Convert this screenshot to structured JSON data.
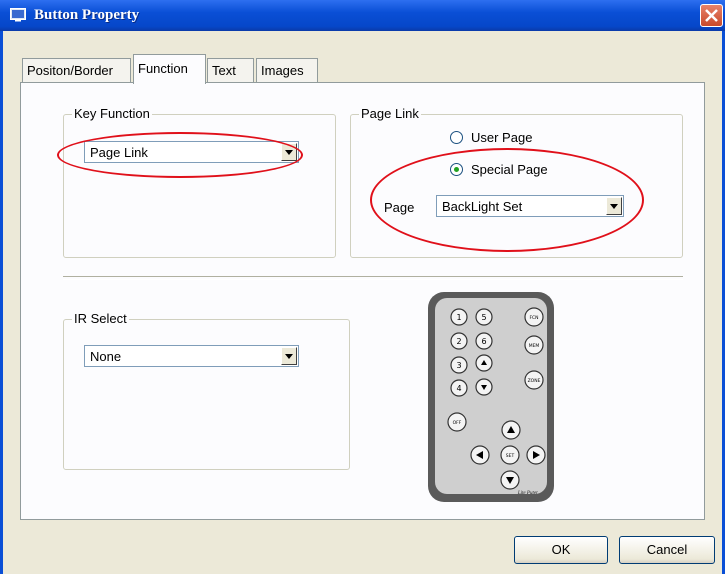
{
  "window": {
    "title": "Button Property",
    "title_icon": "window-app-icon",
    "close_icon": "close-icon",
    "title_bar_color": "#0a4fd6",
    "close_color": "#d45a3c"
  },
  "tabs": [
    {
      "label": "Positon/Border",
      "active": false
    },
    {
      "label": "Function",
      "active": true
    },
    {
      "label": "Text",
      "active": false
    },
    {
      "label": "Images",
      "active": false
    }
  ],
  "key_function": {
    "title": "Key Function",
    "value": "Page Link"
  },
  "page_link": {
    "title": "Page Link",
    "options": [
      {
        "label": "User Page",
        "checked": false
      },
      {
        "label": "Special Page",
        "checked": true
      }
    ],
    "page_label": "Page",
    "page_value": "BackLight Set"
  },
  "ir_select": {
    "title": "IR Select",
    "value": "None"
  },
  "remote": {
    "number_keys": [
      "1",
      "2",
      "3",
      "4",
      "5",
      "6"
    ],
    "function_keys": [
      "FCN",
      "MEM",
      "ZONE",
      "OFF"
    ],
    "center_key": "SET",
    "brand": "Lite Puter"
  },
  "annotation_color": "#e0101a",
  "buttons": {
    "ok": "OK",
    "cancel": "Cancel"
  }
}
